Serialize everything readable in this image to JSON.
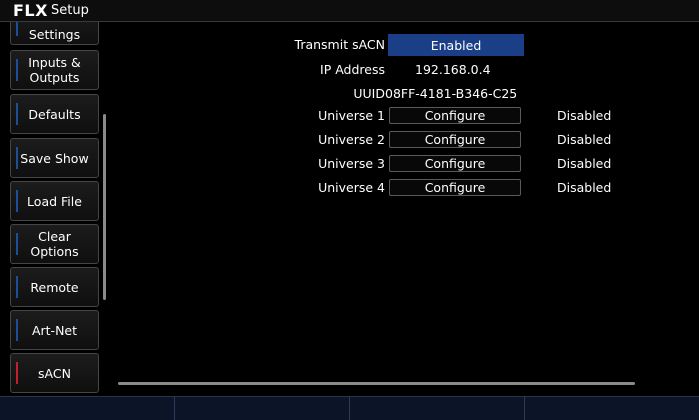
{
  "app": {
    "logo": "FLX",
    "title": "Setup"
  },
  "sidebar": {
    "items": [
      {
        "label": "Settings"
      },
      {
        "label": "Inputs &\nOutputs"
      },
      {
        "label": "Defaults"
      },
      {
        "label": "Save Show"
      },
      {
        "label": "Load File"
      },
      {
        "label": "Clear\nOptions"
      },
      {
        "label": "Remote"
      },
      {
        "label": "Art-Net"
      },
      {
        "label": "sACN",
        "active": true
      }
    ]
  },
  "main": {
    "transmit": {
      "label": "Transmit sACN",
      "value": "Enabled"
    },
    "ip": {
      "label": "IP Address",
      "value": "192.168.0.4"
    },
    "uuid": {
      "label": "UUID",
      "value": "08FF-4181-B346-C25"
    },
    "universes": [
      {
        "label": "Universe 1",
        "button": "Configure",
        "status": "Disabled"
      },
      {
        "label": "Universe 2",
        "button": "Configure",
        "status": "Disabled"
      },
      {
        "label": "Universe 3",
        "button": "Configure",
        "status": "Disabled"
      },
      {
        "label": "Universe 4",
        "button": "Configure",
        "status": "Disabled"
      }
    ]
  },
  "colors": {
    "accent_blue": "#1b3f87",
    "active_red": "#c0222c"
  }
}
